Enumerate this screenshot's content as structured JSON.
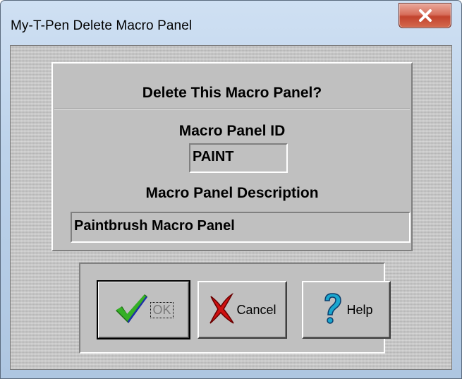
{
  "window": {
    "title": "My-T-Pen Delete Macro Panel"
  },
  "panel": {
    "heading": "Delete This Macro Panel?",
    "id_label": "Macro Panel ID",
    "id_value": "PAINT",
    "description_label": "Macro Panel Description",
    "description_value": "Paintbrush Macro Panel"
  },
  "buttons": {
    "ok": {
      "label": "OK",
      "icon": "check-icon"
    },
    "cancel": {
      "label": "Cancel",
      "icon": "x-mark-icon"
    },
    "help": {
      "label": "Help",
      "icon": "question-mark-icon"
    }
  },
  "colors": {
    "dialog_face": "#c0c0c0",
    "close_button": "#c8452f",
    "check": "#2c9a1e",
    "cancel_x": "#d01010",
    "help_question": "#1aa3c8"
  }
}
